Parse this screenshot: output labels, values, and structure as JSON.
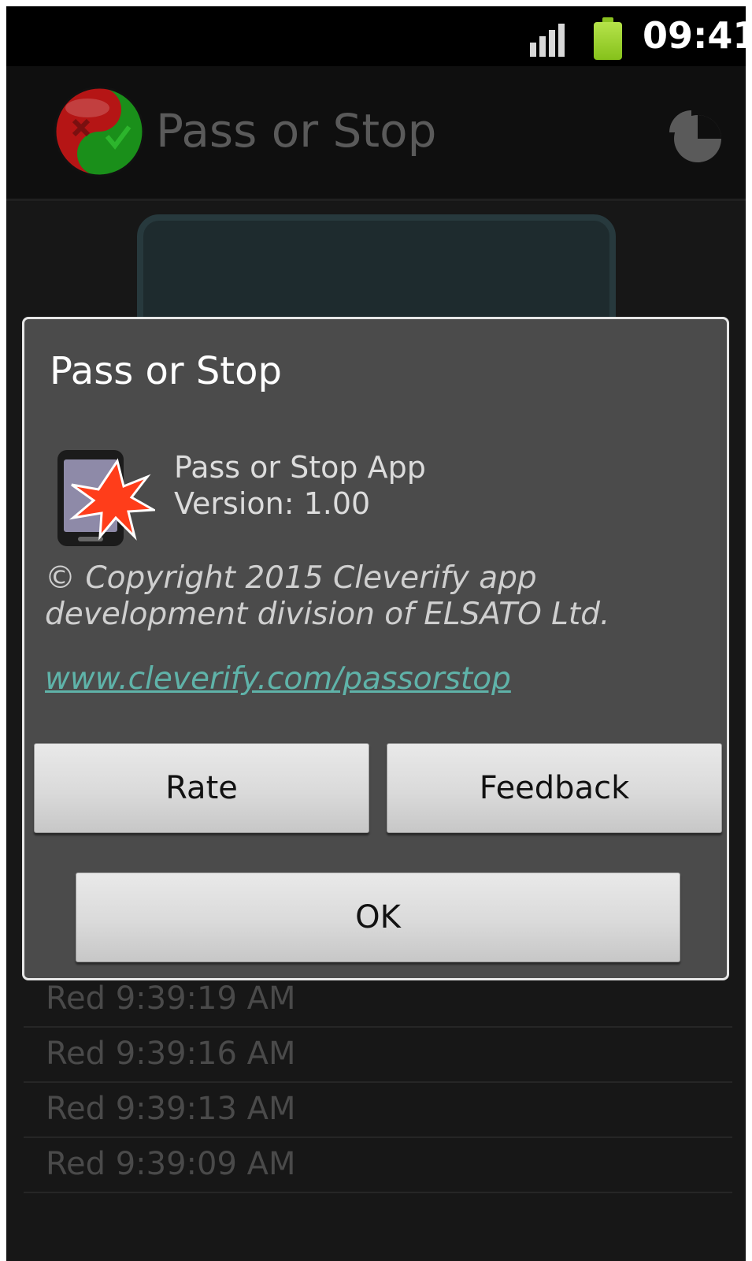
{
  "status_bar": {
    "time": "09:41",
    "icons": [
      "signal-icon",
      "battery-icon"
    ]
  },
  "action_bar": {
    "title": "Pass or Stop",
    "icons": [
      "app-logo-icon",
      "statistics-pie-chart-icon"
    ]
  },
  "log": {
    "entries": [
      "Red 9:39:19 AM",
      "Red 9:39:16 AM",
      "Red 9:39:13 AM",
      "Red 9:39:09 AM"
    ]
  },
  "dialog": {
    "title": "Pass or Stop",
    "app_name": "Pass or Stop App",
    "version": "Version: 1.00",
    "copyright": "© Copyright 2015 Cleverify app development division of ELSATO Ltd.",
    "link": "www.cleverify.com/passorstop",
    "buttons": {
      "rate": "Rate",
      "feedback": "Feedback",
      "ok": "OK"
    }
  },
  "colors": {
    "dialog_bg": "#4b4b4b",
    "link": "#5fb3a9",
    "battery": "#9ad02a",
    "background": "#171717"
  }
}
